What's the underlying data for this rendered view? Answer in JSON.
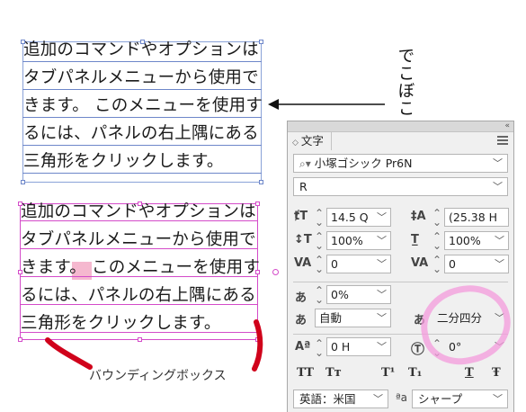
{
  "frame_top": {
    "lines": [
      "追加のコマンドやオプションは",
      "タブパネルメニューから使用で",
      "きます。 このメニューを使用す",
      "るには、パネルの右上隅にある",
      "三角形をクリックします。"
    ]
  },
  "frame_bottom": {
    "lines": [
      "追加のコマンドやオプションは",
      "タブパネルメニューから使用で",
      "きます。 このメニューを使用す",
      "るには、パネルの右上隅にある",
      "三角形をクリックします。"
    ]
  },
  "annotation": {
    "vertical_text": "でこぼこ",
    "bounding_box_label": "バウンディングボックス",
    "marker_color": "#d0021b",
    "highlight_color": "#f5b8cf"
  },
  "panel": {
    "collapse_icon": "«",
    "tab_label": "文字",
    "font_family": "小塚ゴシック Pr6N",
    "font_style": "R",
    "font_size": "14.5 Q",
    "leading": "(25.38 H",
    "vertical_scale": "100%",
    "horizontal_scale": "100%",
    "kerning": "0",
    "tracking": "0",
    "tsume": "0%",
    "mojikumi_left": "自動",
    "mojikumi_right": "二分四分",
    "baseline_shift": "0 H",
    "rotation": "0°",
    "format_buttons": [
      "TT",
      "Tт",
      "T¹",
      "T₁",
      "T",
      "Ŧ"
    ],
    "language": "英語：米国",
    "hyphenation": "シャープ"
  },
  "colors": {
    "frame_top_border": "#8aa2d8",
    "frame_bottom_border": "#d44bc9",
    "pink_circle": "#f49bdc"
  }
}
